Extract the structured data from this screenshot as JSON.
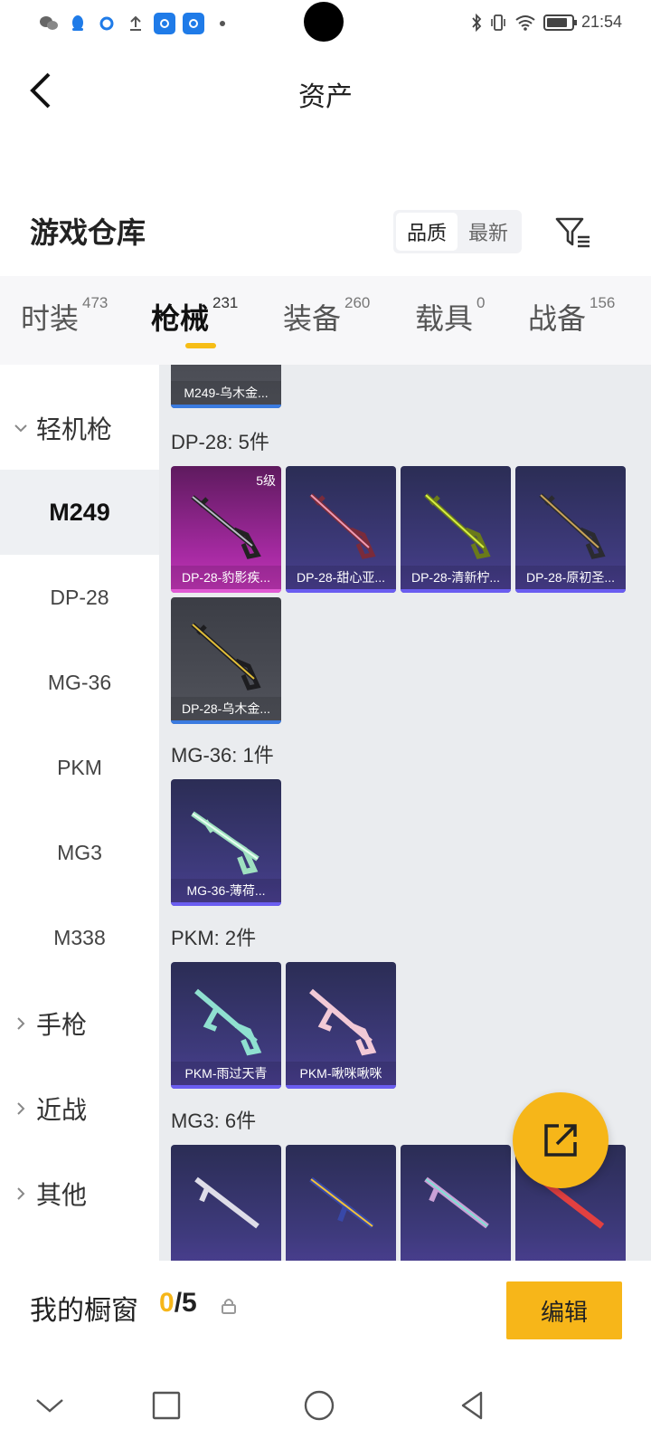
{
  "status_bar": {
    "time": "21:54",
    "left_icons": [
      "wechat-icon",
      "qq-icon",
      "search-app-icon",
      "upload-icon",
      "app-icon",
      "app-icon",
      "dot-icon"
    ],
    "right_icons": [
      "bluetooth-icon",
      "vibrate-icon",
      "wifi-icon",
      "battery-icon"
    ]
  },
  "header": {
    "title": "资产",
    "back_icon": "back-arrow-icon"
  },
  "warehouse": {
    "title": "游戏仓库",
    "sort_options": [
      "品质",
      "最新"
    ],
    "sort_active": "品质",
    "filter_icon": "filter-icon"
  },
  "tabs": [
    {
      "label": "时装",
      "count": "473"
    },
    {
      "label": "枪械",
      "count": "231",
      "active": true
    },
    {
      "label": "装备",
      "count": "260"
    },
    {
      "label": "载具",
      "count": "0"
    },
    {
      "label": "战备",
      "count": "156"
    }
  ],
  "sidebar": {
    "groups": [
      {
        "label": "轻机枪",
        "expanded": true
      },
      {
        "label": "手枪",
        "expanded": false
      },
      {
        "label": "近战",
        "expanded": false
      },
      {
        "label": "其他",
        "expanded": false
      }
    ],
    "items": [
      "M249",
      "DP-28",
      "MG-36",
      "PKM",
      "MG3",
      "M338"
    ],
    "active_item": "M249"
  },
  "content": {
    "partial_top_card": {
      "name": "M249-乌木金..."
    },
    "sections": [
      {
        "label": "DP-28: 5件",
        "cards": [
          {
            "name": "DP-28-豹影疾...",
            "level": "5级",
            "rarity": "pink"
          },
          {
            "name": "DP-28-甜心亚...",
            "rarity": "purple"
          },
          {
            "name": "DP-28-清新柠...",
            "rarity": "purple"
          },
          {
            "name": "DP-28-原初圣...",
            "rarity": "purple"
          },
          {
            "name": "DP-28-乌木金...",
            "rarity": "gray"
          }
        ]
      },
      {
        "label": "MG-36: 1件",
        "cards": [
          {
            "name": "MG-36-薄荷...",
            "rarity": "purple"
          }
        ]
      },
      {
        "label": "PKM: 2件",
        "cards": [
          {
            "name": "PKM-雨过天青",
            "rarity": "purple"
          },
          {
            "name": "PKM-啾咪啾咪",
            "rarity": "purple"
          }
        ]
      },
      {
        "label": "MG3: 6件",
        "cards": [
          {
            "name": "",
            "rarity": "purple"
          },
          {
            "name": "",
            "rarity": "purple"
          },
          {
            "name": "",
            "rarity": "purple"
          },
          {
            "name": "",
            "rarity": "purple"
          }
        ]
      }
    ]
  },
  "fab": {
    "icon": "share-edit-icon"
  },
  "showcase": {
    "label": "我的橱窗",
    "current": "0",
    "separator_total": "/5",
    "lock_icon": "lock-icon",
    "edit_label": "编辑"
  },
  "colors": {
    "accent": "#f6b619",
    "tab_underline": "#f6bd16"
  },
  "navbar": {
    "icons": [
      "collapse-icon",
      "recents-icon",
      "home-icon",
      "back-icon"
    ]
  }
}
